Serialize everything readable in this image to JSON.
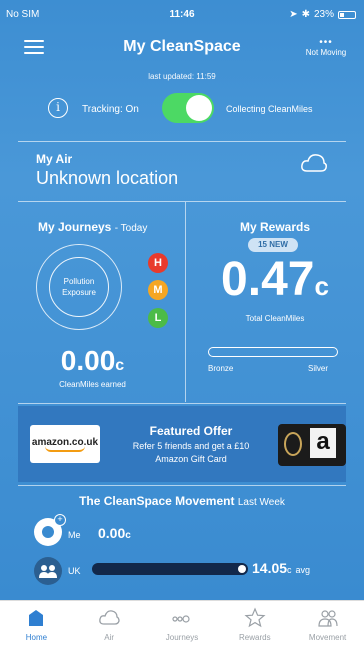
{
  "status_bar": {
    "carrier": "No SIM",
    "time": "11:46",
    "battery": "23%"
  },
  "header": {
    "title": "My CleanSpace",
    "last_updated": "last updated: 11:59",
    "moving_dots": "•••",
    "moving_status": "Not Moving"
  },
  "tracking": {
    "label": "Tracking: On",
    "on": true,
    "status": "Collecting CleanMiles"
  },
  "my_air": {
    "heading": "My Air",
    "location": "Unknown location"
  },
  "journeys": {
    "heading": "My Journeys",
    "period": "- Today",
    "pollution_label_1": "Pollution",
    "pollution_label_2": "Exposure",
    "levels": [
      "H",
      "M",
      "L"
    ],
    "miles_value": "0.00",
    "miles_unit": "c",
    "miles_label": "CleanMiles earned"
  },
  "rewards": {
    "heading": "My Rewards",
    "badge": "15 NEW",
    "value": "0.47",
    "unit": "c",
    "total_label": "Total CleanMiles",
    "progress": 0.0,
    "bronze_label": "Bronze",
    "silver_label": "Silver"
  },
  "offer": {
    "partner_logo": "amazon.co.uk",
    "title": "Featured Offer",
    "line1": "Refer 5 friends and get a £10",
    "line2": "Amazon Gift Card",
    "giftcard_letter": "a"
  },
  "movement": {
    "title": "The CleanSpace Movement",
    "period": "Last Week",
    "me_label": "Me",
    "me_value": "0.00",
    "me_unit": "c",
    "uk_label": "UK",
    "uk_value": "14.05",
    "uk_unit": "c",
    "uk_suffix": "avg"
  },
  "tabs": [
    {
      "label": "Home",
      "icon": "home-icon",
      "active": true
    },
    {
      "label": "Air",
      "icon": "cloud-icon",
      "active": false
    },
    {
      "label": "Journeys",
      "icon": "journeys-icon",
      "active": false
    },
    {
      "label": "Rewards",
      "icon": "star-icon",
      "active": false
    },
    {
      "label": "Movement",
      "icon": "people-icon",
      "active": false
    }
  ],
  "colors": {
    "accent": "#3a8bd0",
    "toggle_on": "#4cd964",
    "tab_active": "#2f7fd1"
  }
}
